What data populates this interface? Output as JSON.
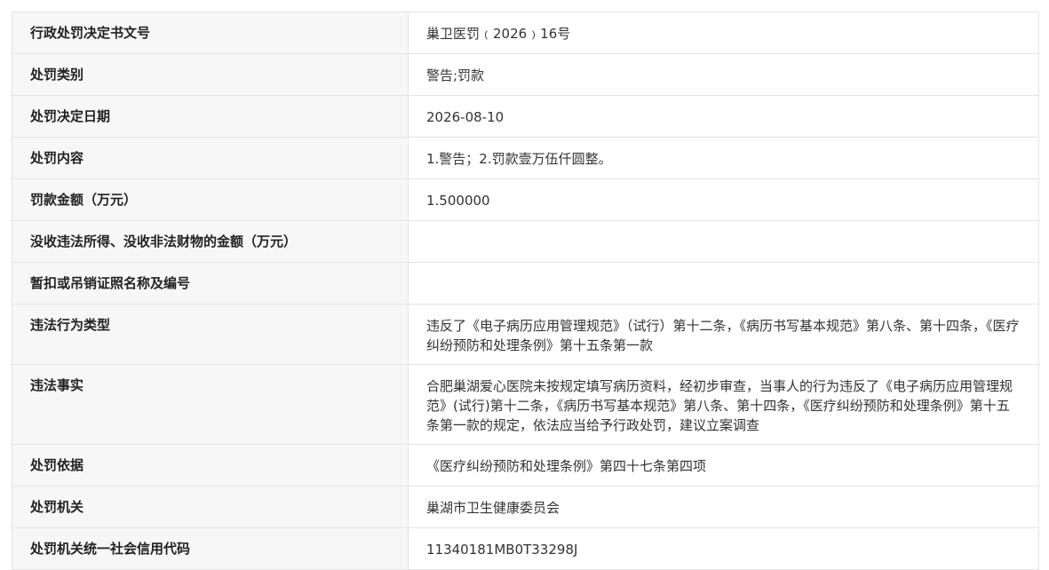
{
  "rows": [
    {
      "label": "行政处罚决定书文号",
      "value": "巢卫医罚﹙2026﹚16号"
    },
    {
      "label": "处罚类别",
      "value": "警告;罚款"
    },
    {
      "label": "处罚决定日期",
      "value": "2026-08-10"
    },
    {
      "label": "处罚内容",
      "value": "1.警告；2.罚款壹万伍仟圆整。"
    },
    {
      "label": "罚款金额（万元）",
      "value": "1.500000"
    },
    {
      "label": "没收违法所得、没收非法财物的金额（万元）",
      "value": ""
    },
    {
      "label": "暂扣或吊销证照名称及编号",
      "value": ""
    },
    {
      "label": "违法行为类型",
      "value": "违反了《电子病历应用管理规范》（试行）第十二条，《病历书写基本规范》第八条、第十四条，《医疗纠纷预防和处理条例》第十五条第一款"
    },
    {
      "label": "违法事实",
      "value": "合肥巢湖爱心医院未按规定填写病历资料，经初步审查，当事人的行为违反了《电子病历应用管理规范》(试行)第十二条，《病历书写基本规范》第八条、第十四条，《医疗纠纷预防和处理条例》第十五条第一款的规定，依法应当给予行政处罚，建议立案调查"
    },
    {
      "label": "处罚依据",
      "value": "《医疗纠纷预防和处理条例》第四十七条第四项"
    },
    {
      "label": "处罚机关",
      "value": "巢湖市卫生健康委员会"
    },
    {
      "label": "处罚机关统一社会信用代码",
      "value": "11340181MB0T33298J"
    }
  ]
}
